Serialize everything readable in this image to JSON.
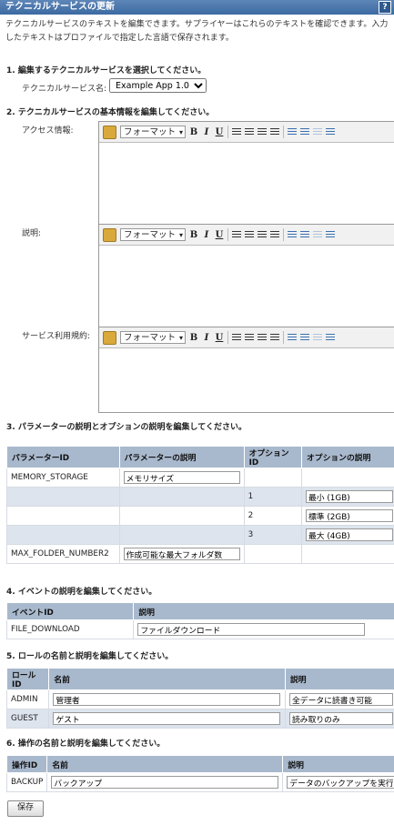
{
  "header": {
    "title": "テクニカルサービスの更新",
    "help": "?"
  },
  "intro": "テクニカルサービスのテキストを編集できます。サプライヤーはこれらのテキストを確認できます。入力したテキストはプロファイルで指定した言語で保存されます。",
  "section1": {
    "heading": "1. 編集するテクニカルサービスを選択してください。",
    "label": "テクニカルサービス名:",
    "selected": "Example App 1.0"
  },
  "section2": {
    "heading": "2. テクニカルサービスの基本情報を編集してください。",
    "toolbar": {
      "format": "フォーマット",
      "bold": "B",
      "italic": "I",
      "underline": "U"
    },
    "editors": [
      {
        "label": "アクセス情報:"
      },
      {
        "label": "説明:"
      },
      {
        "label": "サービス利用規約:"
      }
    ]
  },
  "section3": {
    "heading": "3. パラメーターの説明とオプションの説明を編集してください。",
    "columns": [
      "パラメーターID",
      "パラメーターの説明",
      "オプションID",
      "オプションの説明"
    ],
    "rows": [
      {
        "param_id": "MEMORY_STORAGE",
        "param_desc": "メモリサイズ",
        "option_id": "",
        "option_desc": ""
      },
      {
        "param_id": "",
        "param_desc": "",
        "option_id": "1",
        "option_desc": "最小 (1GB)"
      },
      {
        "param_id": "",
        "param_desc": "",
        "option_id": "2",
        "option_desc": "標準 (2GB)"
      },
      {
        "param_id": "",
        "param_desc": "",
        "option_id": "3",
        "option_desc": "最大 (4GB)"
      },
      {
        "param_id": "MAX_FOLDER_NUMBER2",
        "param_desc": "作成可能な最大フォルダ数",
        "option_id": "",
        "option_desc": ""
      }
    ]
  },
  "section4": {
    "heading": "4. イベントの説明を編集してください。",
    "columns": [
      "イベントID",
      "説明"
    ],
    "rows": [
      {
        "id": "FILE_DOWNLOAD",
        "desc": "ファイルダウンロード"
      }
    ]
  },
  "section5": {
    "heading": "5. ロールの名前と説明を編集してください。",
    "columns": [
      "ロールID",
      "名前",
      "説明"
    ],
    "rows": [
      {
        "id": "ADMIN",
        "name": "管理者",
        "desc": "全データに読書き可能"
      },
      {
        "id": "GUEST",
        "name": "ゲスト",
        "desc": "読み取りのみ"
      }
    ]
  },
  "section6": {
    "heading": "6. 操作の名前と説明を編集してください。",
    "columns": [
      "操作ID",
      "名前",
      "説明"
    ],
    "rows": [
      {
        "id": "BACKUP",
        "name": "バックアップ",
        "desc": "データのバックアップを実行"
      }
    ]
  },
  "save_label": "保存"
}
